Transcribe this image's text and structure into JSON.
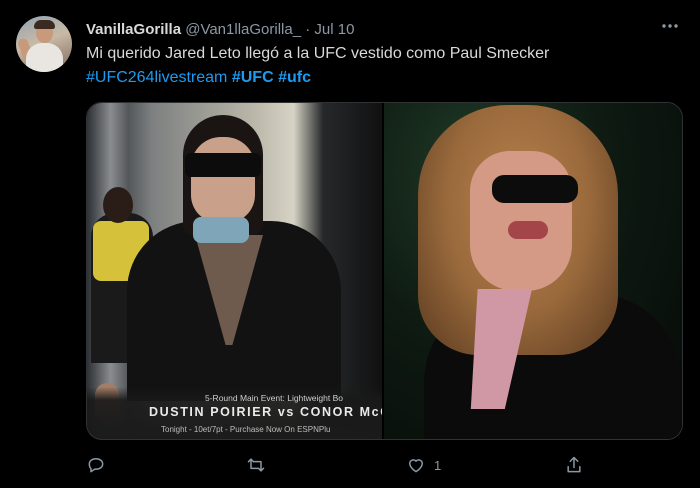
{
  "tweet": {
    "display_name": "VanillaGorilla",
    "handle": "@Van1llaGorilla_",
    "separator": "·",
    "date": "Jul 10",
    "text": "Mi querido Jared Leto llegó a la UFC vestido como Paul Smecker",
    "hashtags": [
      "#UFC264livestream",
      "#UFC",
      "#ufc"
    ],
    "more_icon": "more-icon"
  },
  "media": {
    "caption_line1": "5-Round Main Event: Lightweight Bo",
    "caption_line2": "DUSTIN POIRIER vs CONOR McG",
    "caption_line3": "Tonight - 10et/7pt - Purchase Now On ESPNPlu"
  },
  "actions": {
    "reply_icon": "reply-icon",
    "retweet_icon": "retweet-icon",
    "like_icon": "like-icon",
    "like_count": "1",
    "share_icon": "share-icon"
  },
  "colors": {
    "background": "#000000",
    "text": "#d9d9d9",
    "muted": "#8b98a5",
    "link": "#1d9bf0"
  }
}
